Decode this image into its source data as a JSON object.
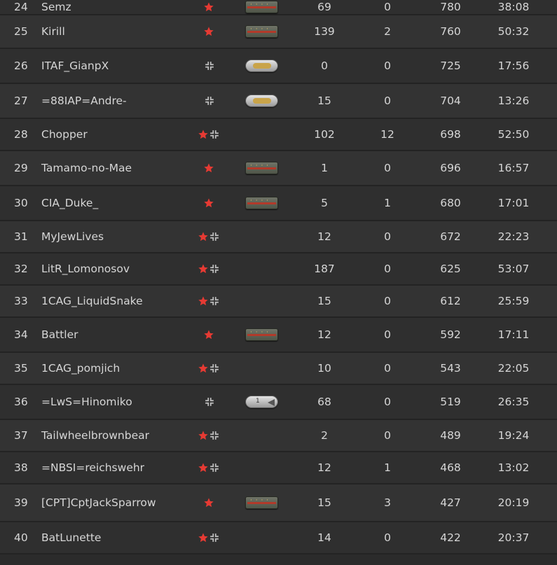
{
  "colors": {
    "background": "#2b2b2b",
    "row_odd": "#2f2f2f",
    "row_even": "#333333",
    "text": "#d6d6d6",
    "star_red": "#e63a33",
    "cross_gray": "#bfbfbf"
  },
  "rows": [
    {
      "pos": "24",
      "name": "Semz",
      "factions": "star",
      "rank": "soviet",
      "kills": "69",
      "deaths": "0",
      "score": "780",
      "time": "38:08",
      "height": 22
    },
    {
      "pos": "25",
      "name": "Kirill",
      "factions": "star",
      "rank": "soviet",
      "kills": "139",
      "deaths": "2",
      "score": "760",
      "time": "50:32",
      "height": 48
    },
    {
      "pos": "26",
      "name": "ITAF_GianpX",
      "factions": "cross",
      "rank": "german",
      "kills": "0",
      "deaths": "0",
      "score": "725",
      "time": "17:56",
      "height": 50
    },
    {
      "pos": "27",
      "name": "=88IAP=Andre-",
      "factions": "cross",
      "rank": "german",
      "kills": "15",
      "deaths": "0",
      "score": "704",
      "time": "13:26",
      "height": 50
    },
    {
      "pos": "28",
      "name": "Chopper",
      "factions": "both",
      "rank": "",
      "kills": "102",
      "deaths": "12",
      "score": "698",
      "time": "52:50",
      "height": 46
    },
    {
      "pos": "29",
      "name": "Tamamo-no-Mae",
      "factions": "star",
      "rank": "soviet",
      "kills": "1",
      "deaths": "0",
      "score": "696",
      "time": "16:57",
      "height": 50
    },
    {
      "pos": "30",
      "name": "CIA_Duke_",
      "factions": "star",
      "rank": "soviet",
      "kills": "5",
      "deaths": "1",
      "score": "680",
      "time": "17:01",
      "height": 50
    },
    {
      "pos": "31",
      "name": "MyJewLives",
      "factions": "both",
      "rank": "",
      "kills": "12",
      "deaths": "0",
      "score": "672",
      "time": "22:23",
      "height": 46
    },
    {
      "pos": "32",
      "name": "LitR_Lomonosov",
      "factions": "both",
      "rank": "",
      "kills": "187",
      "deaths": "0",
      "score": "625",
      "time": "53:07",
      "height": 46
    },
    {
      "pos": "33",
      "name": "1CAG_LiquidSnake",
      "factions": "both",
      "rank": "",
      "kills": "15",
      "deaths": "0",
      "score": "612",
      "time": "25:59",
      "height": 46
    },
    {
      "pos": "34",
      "name": "Battler",
      "factions": "star",
      "rank": "soviet",
      "kills": "12",
      "deaths": "0",
      "score": "592",
      "time": "17:11",
      "height": 50
    },
    {
      "pos": "35",
      "name": "1CAG_pomjich",
      "factions": "both",
      "rank": "",
      "kills": "10",
      "deaths": "0",
      "score": "543",
      "time": "22:05",
      "height": 46
    },
    {
      "pos": "36",
      "name": "=LwS=Hinomiko",
      "factions": "cross",
      "rank": "german2",
      "kills": "68",
      "deaths": "0",
      "score": "519",
      "time": "26:35",
      "height": 50
    },
    {
      "pos": "37",
      "name": "Tailwheelbrownbear",
      "factions": "both",
      "rank": "",
      "kills": "2",
      "deaths": "0",
      "score": "489",
      "time": "19:24",
      "height": 46
    },
    {
      "pos": "38",
      "name": "=NBSI=reichswehr",
      "factions": "both",
      "rank": "",
      "kills": "12",
      "deaths": "1",
      "score": "468",
      "time": "13:02",
      "height": 46
    },
    {
      "pos": "39",
      "name": "[CPT]CptJackSparrow",
      "factions": "star",
      "rank": "soviet",
      "kills": "15",
      "deaths": "3",
      "score": "427",
      "time": "20:19",
      "height": 54
    },
    {
      "pos": "40",
      "name": "BatLunette",
      "factions": "both",
      "rank": "",
      "kills": "14",
      "deaths": "0",
      "score": "422",
      "time": "20:37",
      "height": 46
    }
  ]
}
